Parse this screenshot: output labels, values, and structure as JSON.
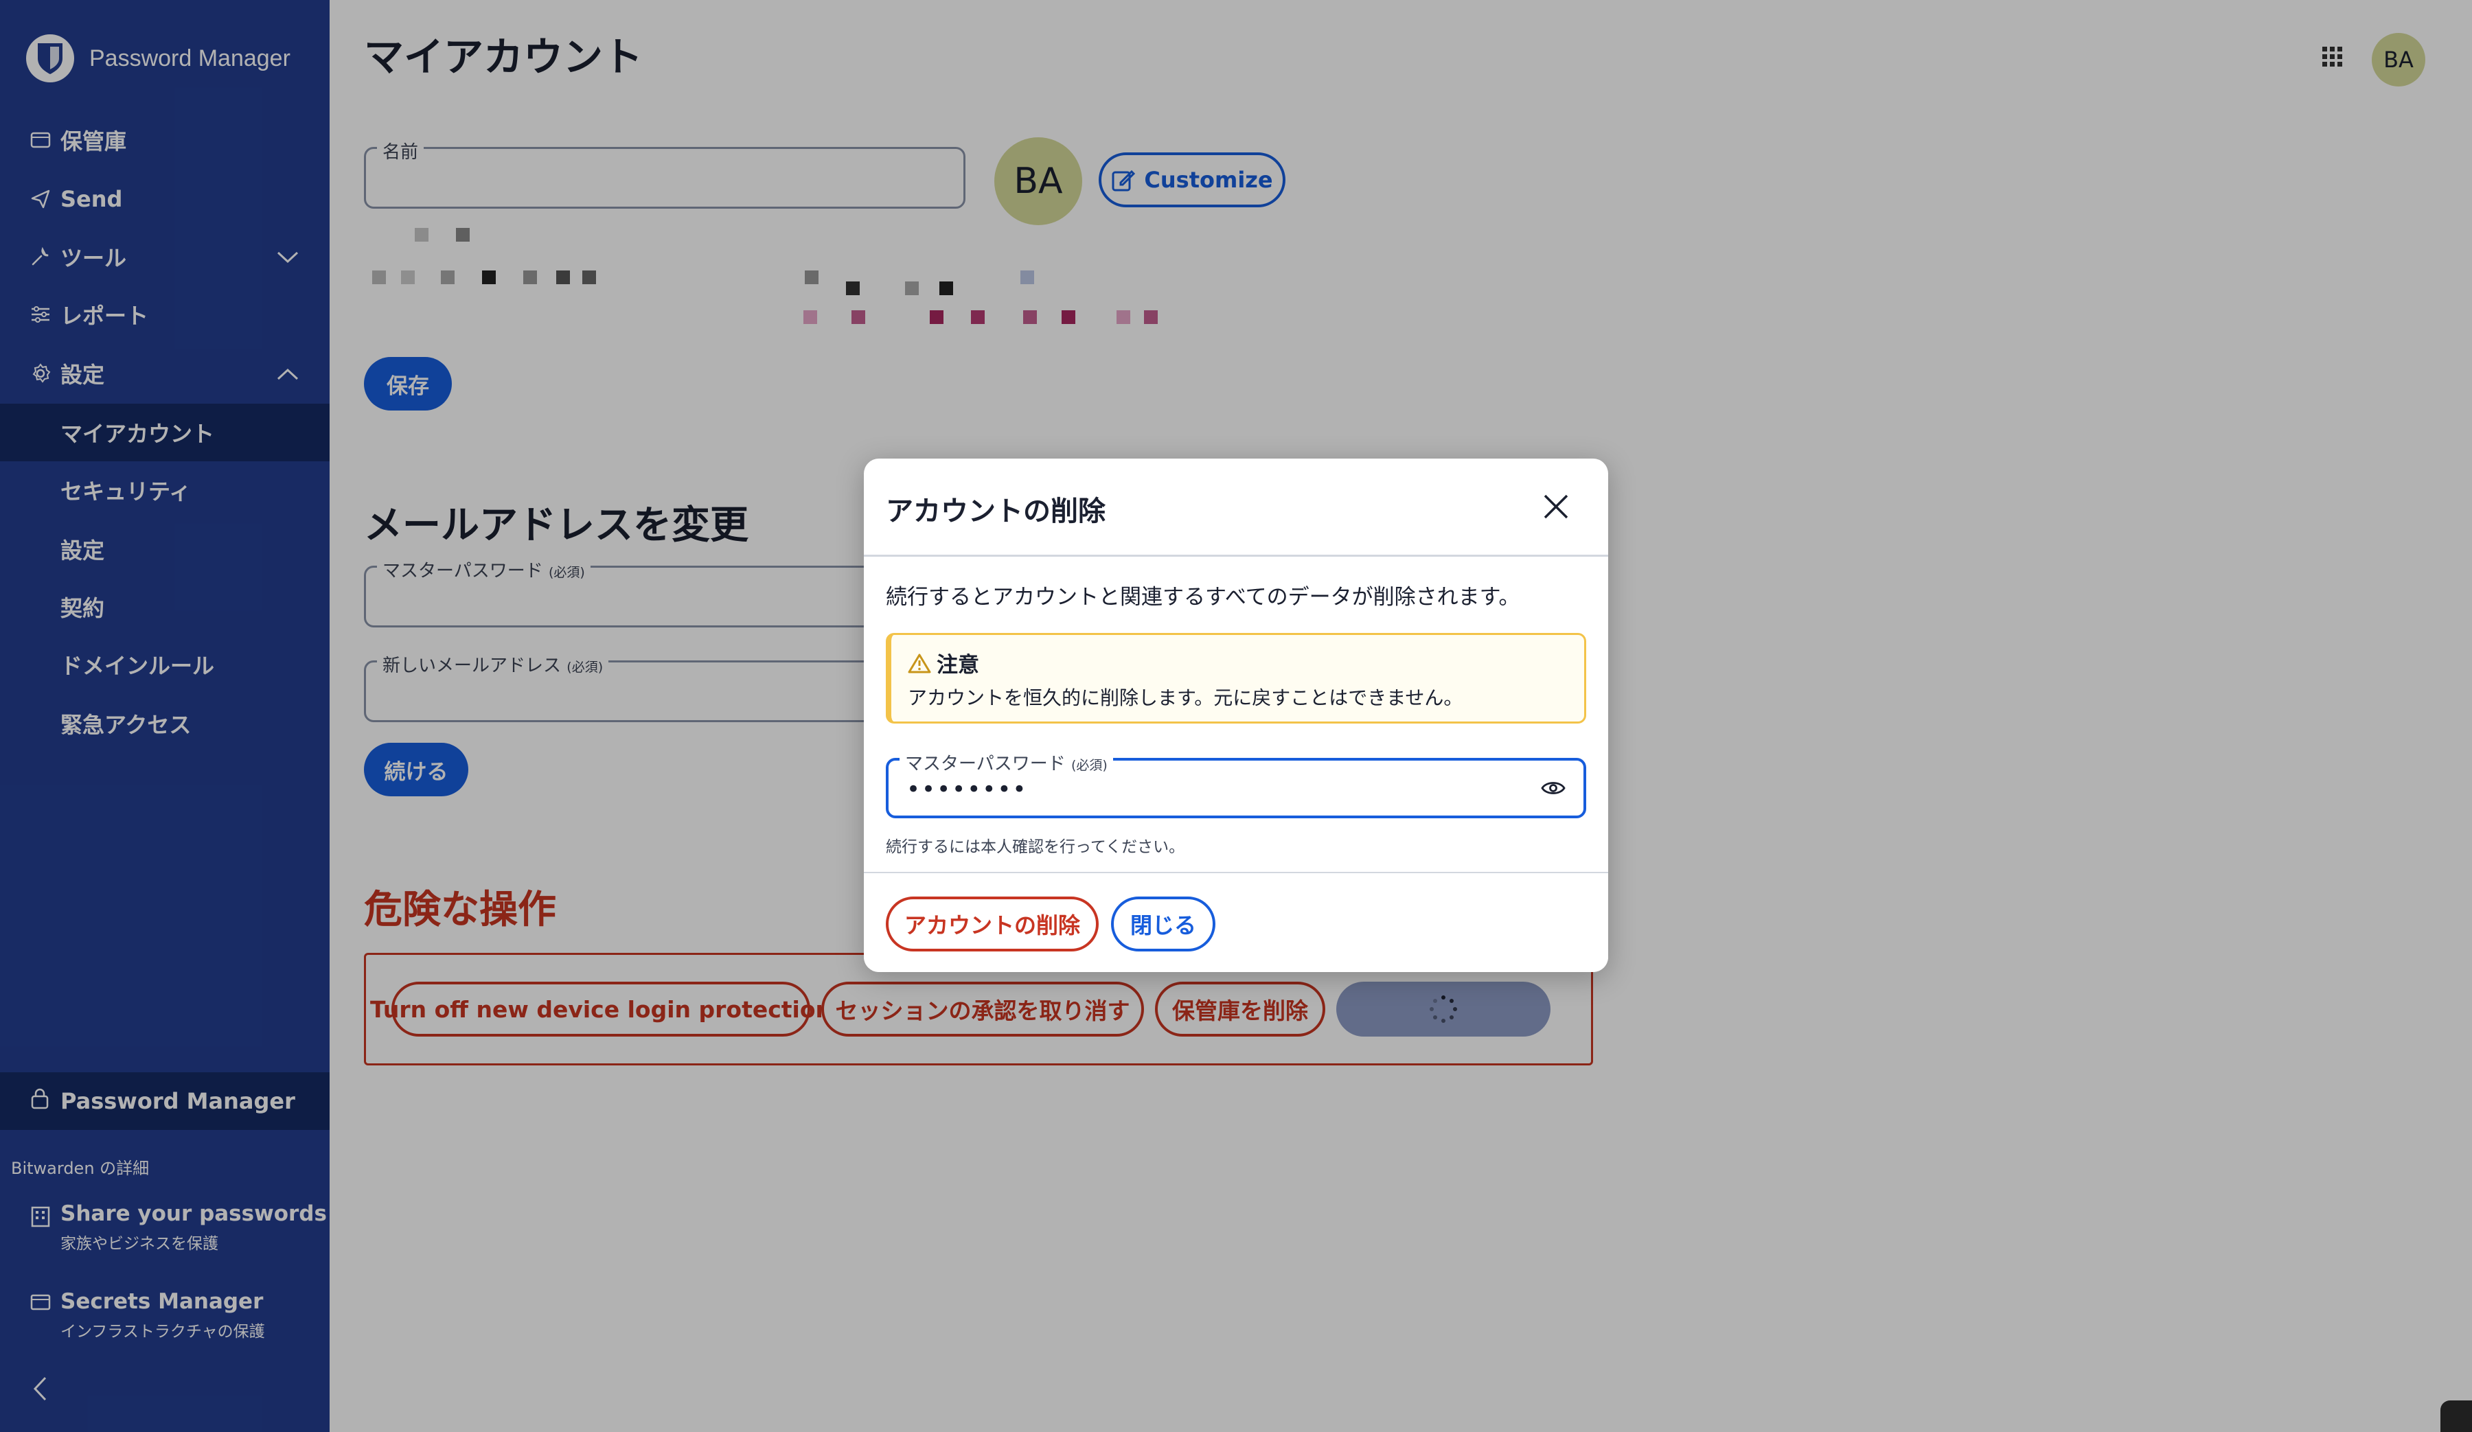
{
  "app": {
    "brand": "Password Manager"
  },
  "sidebar": {
    "items": [
      {
        "label": "保管庫",
        "icon": "vault-icon"
      },
      {
        "label": "Send",
        "icon": "send-icon"
      },
      {
        "label": "ツール",
        "icon": "wrench-icon"
      },
      {
        "label": "レポート",
        "icon": "sliders-icon"
      },
      {
        "label": "設定",
        "icon": "gear-icon"
      }
    ],
    "settings_sub": [
      {
        "label": "マイアカウント",
        "active": true
      },
      {
        "label": "セキュリティ"
      },
      {
        "label": "設定"
      },
      {
        "label": "契約"
      },
      {
        "label": "ドメインルール"
      },
      {
        "label": "緊急アクセス"
      }
    ],
    "product_switcher": "Password Manager",
    "more_title": "Bitwarden の詳細",
    "promos": [
      {
        "title": "Share your passwords",
        "subtitle": "家族やビジネスを保護",
        "icon": "building-icon"
      },
      {
        "title": "Secrets Manager",
        "subtitle": "インフラストラクチャの保護",
        "icon": "window-icon"
      }
    ]
  },
  "header": {
    "title": "マイアカウント",
    "avatar": "BA"
  },
  "profile": {
    "name_label": "名前",
    "name_value": "",
    "avatar": "BA",
    "customize": "Customize",
    "save": "保存"
  },
  "email_section": {
    "title": "メールアドレスを変更",
    "master_password_label": "マスターパスワード",
    "required": "(必須)",
    "new_email_label": "新しいメールアドレス",
    "continue": "続ける"
  },
  "danger": {
    "title": "危険な操作",
    "buttons": [
      "Turn off new device login protection",
      "セッションの承認を取り消す",
      "保管庫を削除"
    ]
  },
  "dialog": {
    "title": "アカウントの削除",
    "description": "続行するとアカウントと関連するすべてのデータが削除されます。",
    "warning_title": "注意",
    "warning_text": "アカウントを恒久的に削除します。元に戻すことはできません。",
    "password_label": "マスターパスワード",
    "required": "(必須)",
    "password_value": "••••••••",
    "hint": "続行するには本人確認を行ってください。",
    "delete_button": "アカウントの削除",
    "close_button": "閉じる"
  },
  "colors": {
    "sidebar": "#233d8f",
    "sidebar_active": "#152a63",
    "primary": "#175ddc",
    "danger": "#c83522",
    "warning": "#f3c349"
  }
}
